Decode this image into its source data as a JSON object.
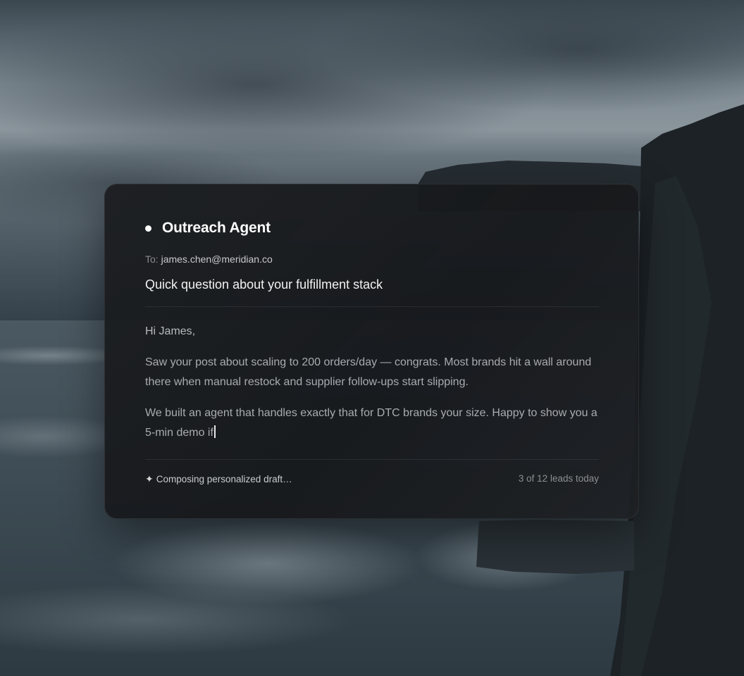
{
  "agent": {
    "title": "Outreach Agent"
  },
  "email": {
    "to_label": "To:",
    "to_address": "james.chen@meridian.co",
    "subject": "Quick question about your fulfillment stack",
    "greeting": "Hi James,",
    "paragraph_1": "Saw your post about scaling to 200 orders/day — congrats. Most brands hit a wall around there when manual restock and supplier follow-ups start slipping.",
    "paragraph_2": "We built an agent that handles exactly that for DTC brands your size. Happy to show you a 5-min demo if"
  },
  "status": {
    "icon": "sparkle-icon",
    "text": "Composing personalized draft…",
    "progress_text": "3 of 12 leads today"
  }
}
